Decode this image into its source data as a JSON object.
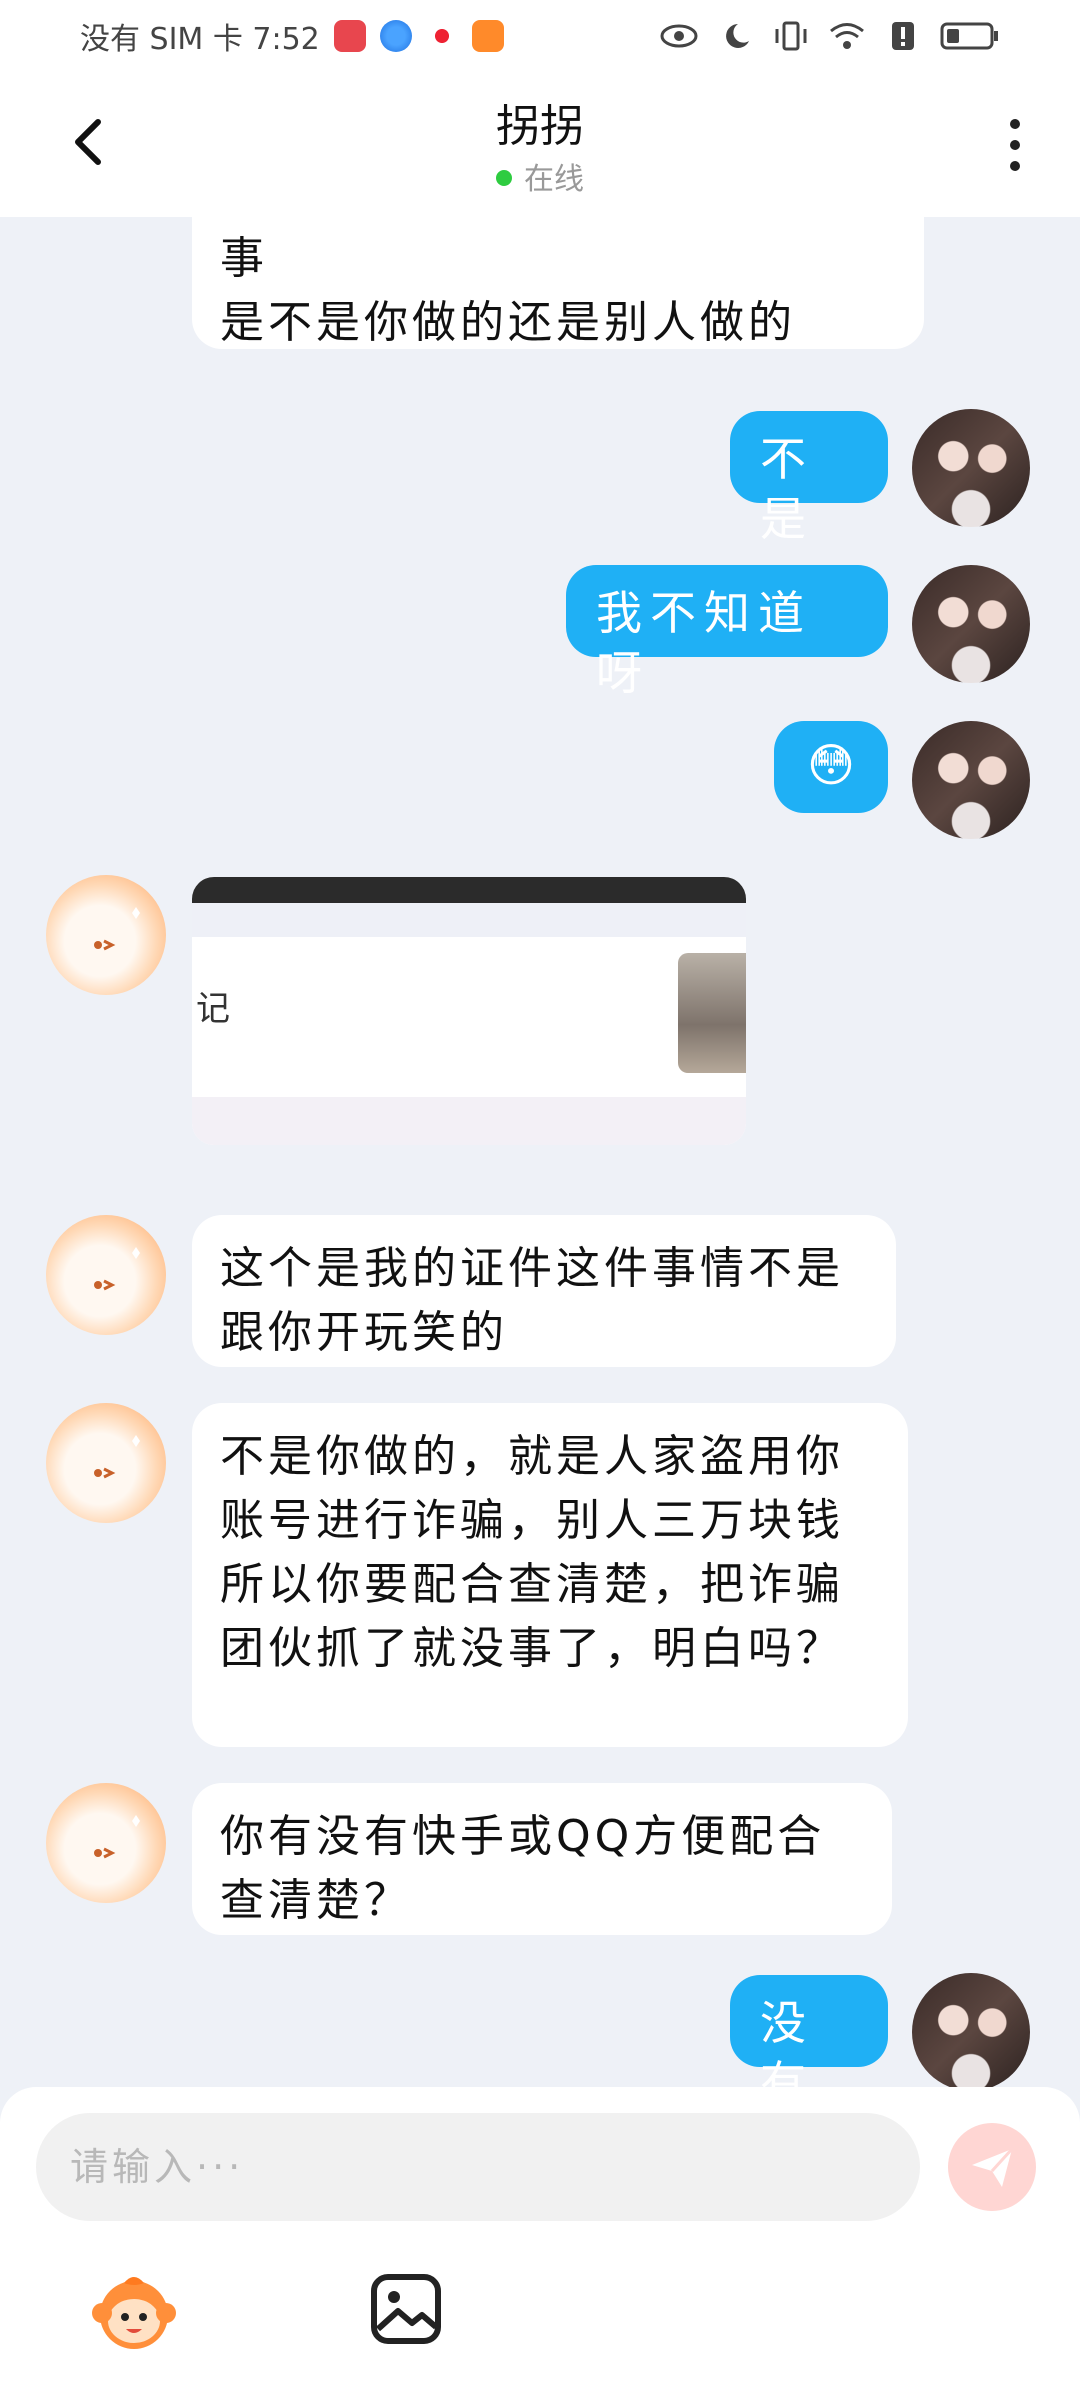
{
  "status_bar": {
    "carrier_time": "没有 SIM 卡 7:52",
    "app_icons": [
      "huawei-appgallery-icon",
      "browser-icon",
      "camera-icon",
      "video-icon"
    ],
    "right_icons": [
      "eye-icon",
      "moon-icon",
      "vibrate-icon",
      "wifi-icon",
      "alert-icon",
      "battery-icon"
    ]
  },
  "header": {
    "title": "拐拐",
    "status": "在线",
    "status_color": "#2ecc40"
  },
  "messages": [
    {
      "side": "incoming",
      "type": "text",
      "text_line1": "事",
      "text_line2": "是不是你做的还是别人做的"
    },
    {
      "side": "outgoing",
      "type": "text",
      "text": "不是"
    },
    {
      "side": "outgoing",
      "type": "text",
      "text": "我不知道呀"
    },
    {
      "side": "outgoing",
      "type": "text",
      "text": "😳"
    },
    {
      "side": "incoming",
      "type": "image",
      "visible_text": "记"
    },
    {
      "side": "incoming",
      "type": "text",
      "text": "这个是我的证件这件事情不是跟你开玩笑的"
    },
    {
      "side": "incoming",
      "type": "text",
      "text": "不是你做的，就是人家盗用你账号进行诈骗，别人三万块钱 所以你要配合查清楚，把诈骗团伙抓了就没事了，明白吗？"
    },
    {
      "side": "incoming",
      "type": "text",
      "text": "你有没有快手或QQ方便配合查清楚？"
    },
    {
      "side": "outgoing",
      "type": "text",
      "text": "没有"
    }
  ],
  "input": {
    "placeholder": "请输入···",
    "value": ""
  },
  "toolbar": {
    "emoji_icon": "monkey-emoji-icon",
    "image_icon": "image-icon"
  },
  "colors": {
    "outgoing_bubble": "#1fb0f5",
    "incoming_bubble": "#ffffff",
    "chat_background": "#eef1f7",
    "send_button": "#ffd6d3"
  }
}
